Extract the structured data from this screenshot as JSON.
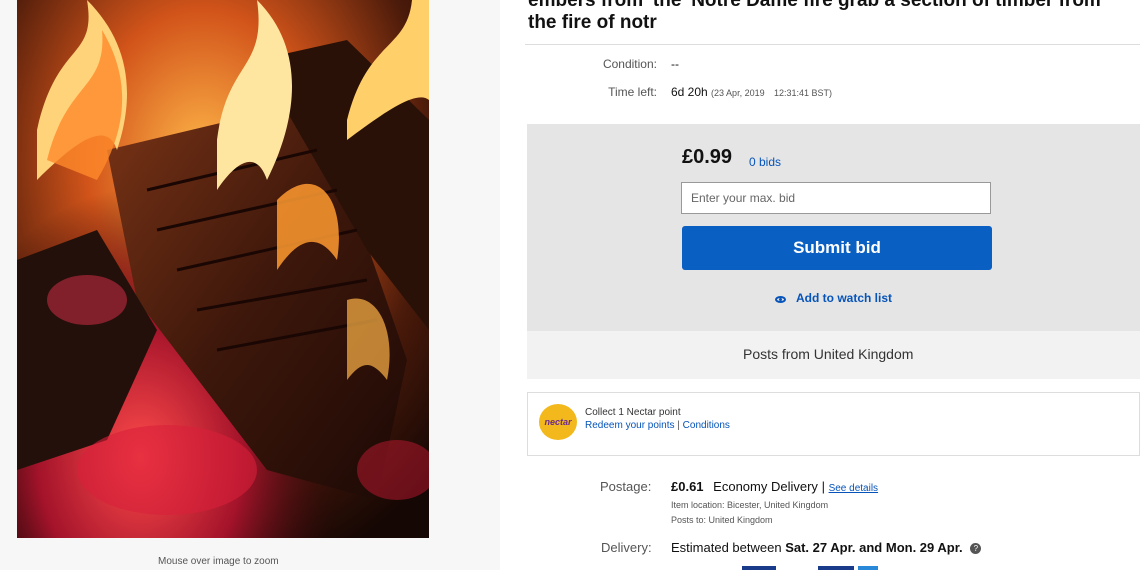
{
  "image": {
    "zoom_hint": "Mouse over image to zoom"
  },
  "listing": {
    "title": "embers from 'the' Notre Dame fire grab a section of timber from the fire of notr",
    "condition_label": "Condition:",
    "condition_value": "--",
    "time_left_label": "Time left:",
    "time_left_value": "6d 20h",
    "end_date": "(23 Apr, 2019",
    "end_time": "12:31:41 BST)"
  },
  "bid": {
    "price": "£0.99",
    "bids_count": "0 bids",
    "input_placeholder": "Enter your max. bid",
    "submit_label": "Submit bid",
    "watch_label": "Add to watch list",
    "posts_from": "Posts from United Kingdom"
  },
  "nectar": {
    "logo_text": "nectar",
    "collect_text": "Collect 1 Nectar point",
    "redeem_link": "Redeem your points",
    "separator": "|",
    "conditions_link": "Conditions"
  },
  "shipping": {
    "postage_label": "Postage:",
    "postage_price": "£0.61",
    "postage_service": "Economy Delivery",
    "separator": "|",
    "see_details": "See details",
    "item_location": "Item location:  Bicester, United Kingdom",
    "posts_to": "Posts to:  United Kingdom",
    "delivery_label": "Delivery:",
    "delivery_prefix": "Estimated between",
    "delivery_dates": "Sat. 27 Apr. and Mon. 29 Apr.",
    "info_icon_glyph": "?"
  },
  "colors": {
    "link_blue": "#0654ba",
    "button_blue": "#0a5fc2",
    "bid_box_gray": "#e5e5e5",
    "nectar_yellow": "#f2b81c"
  }
}
